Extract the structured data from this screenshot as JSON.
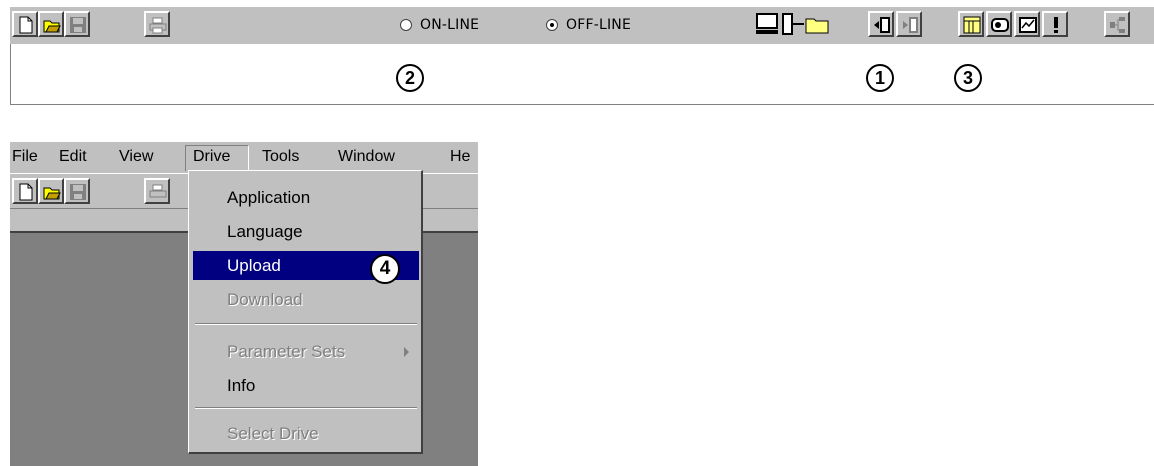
{
  "top_toolbar": {
    "online_label": "ON-LINE",
    "offline_label": "OFF-LINE",
    "selected_mode": "OFF-LINE",
    "icons": [
      "new-file-icon",
      "open-folder-icon",
      "save-icon",
      "print-icon",
      "pc-drive-folder-icon",
      "upload-icon",
      "download-icon",
      "parameter-table-icon",
      "drive-view-icon",
      "monitor-icon",
      "fault-icon",
      "tree-icon"
    ]
  },
  "callouts": {
    "c1": "1",
    "c2": "2",
    "c3": "3",
    "c4": "4"
  },
  "menubar": {
    "file": "File",
    "edit": "Edit",
    "view": "View",
    "drive": "Drive",
    "tools": "Tools",
    "window": "Window",
    "help": "He"
  },
  "drive_menu": {
    "items": [
      {
        "label": "Application",
        "state": "normal"
      },
      {
        "label": "Language",
        "state": "normal"
      },
      {
        "label": "Upload",
        "state": "selected"
      },
      {
        "label": "Download",
        "state": "disabled"
      },
      {
        "label": "Parameter Sets",
        "state": "disabled"
      },
      {
        "label": "Info",
        "state": "normal"
      },
      {
        "label": "Select Drive",
        "state": "disabled"
      }
    ]
  },
  "colors": {
    "face": "#c0c0c0",
    "highlight": "#000080",
    "workspace": "#808080"
  }
}
